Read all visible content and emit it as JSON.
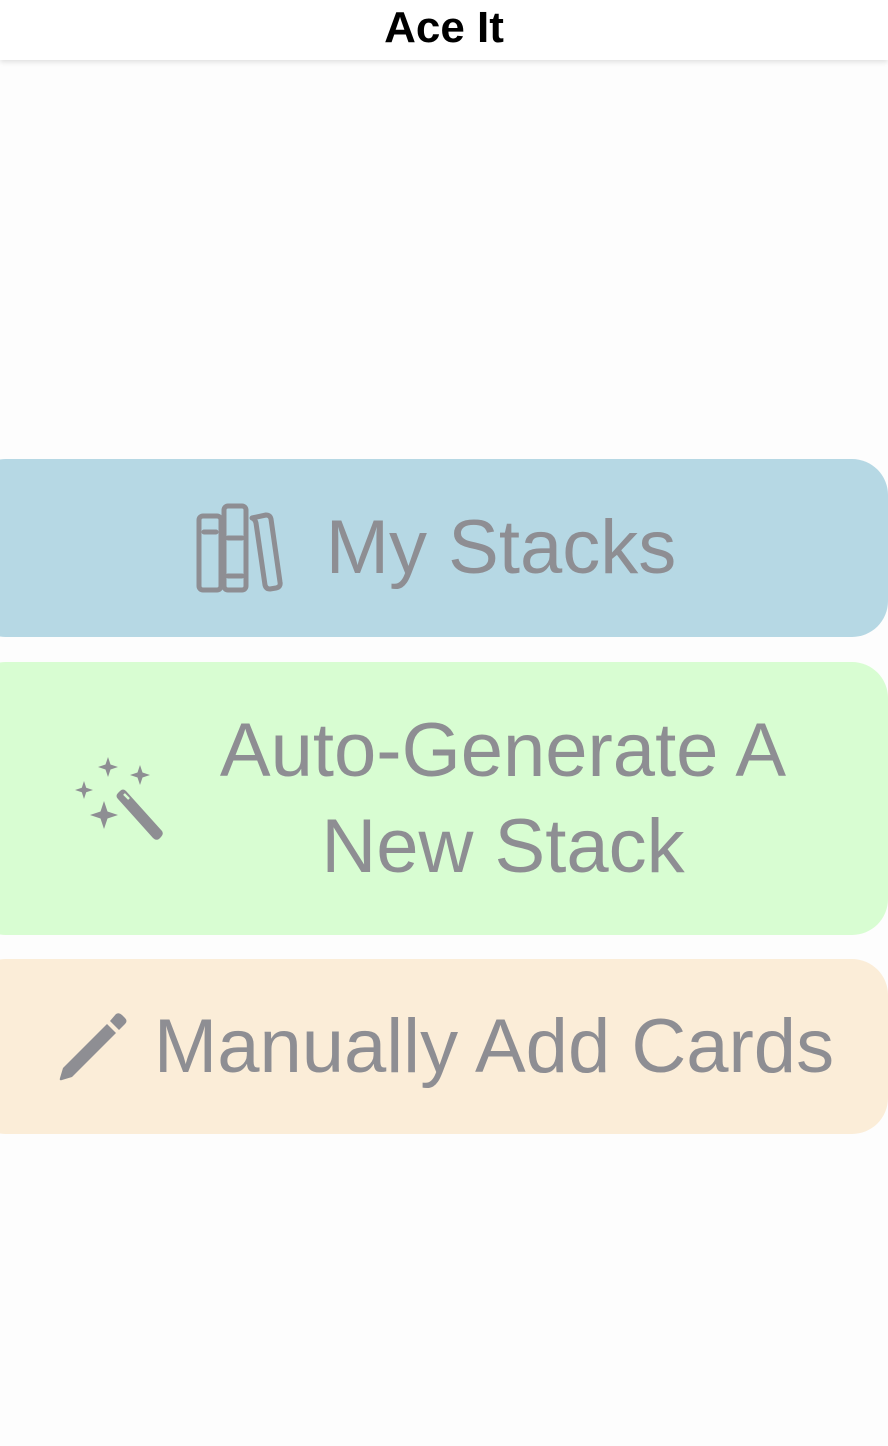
{
  "app": {
    "title": "Ace It"
  },
  "menu": {
    "items": [
      {
        "label": "My Stacks",
        "icon": "books-icon",
        "color": "#b6d8e4"
      },
      {
        "label": "Auto-Generate A New Stack",
        "icon": "magic-wand-icon",
        "color": "#d8fdd2"
      },
      {
        "label": "Manually Add Cards",
        "icon": "pencil-icon",
        "color": "#fbedd8"
      }
    ]
  },
  "colors": {
    "label_text": "#8e8e93",
    "background": "#fdfdfd"
  }
}
